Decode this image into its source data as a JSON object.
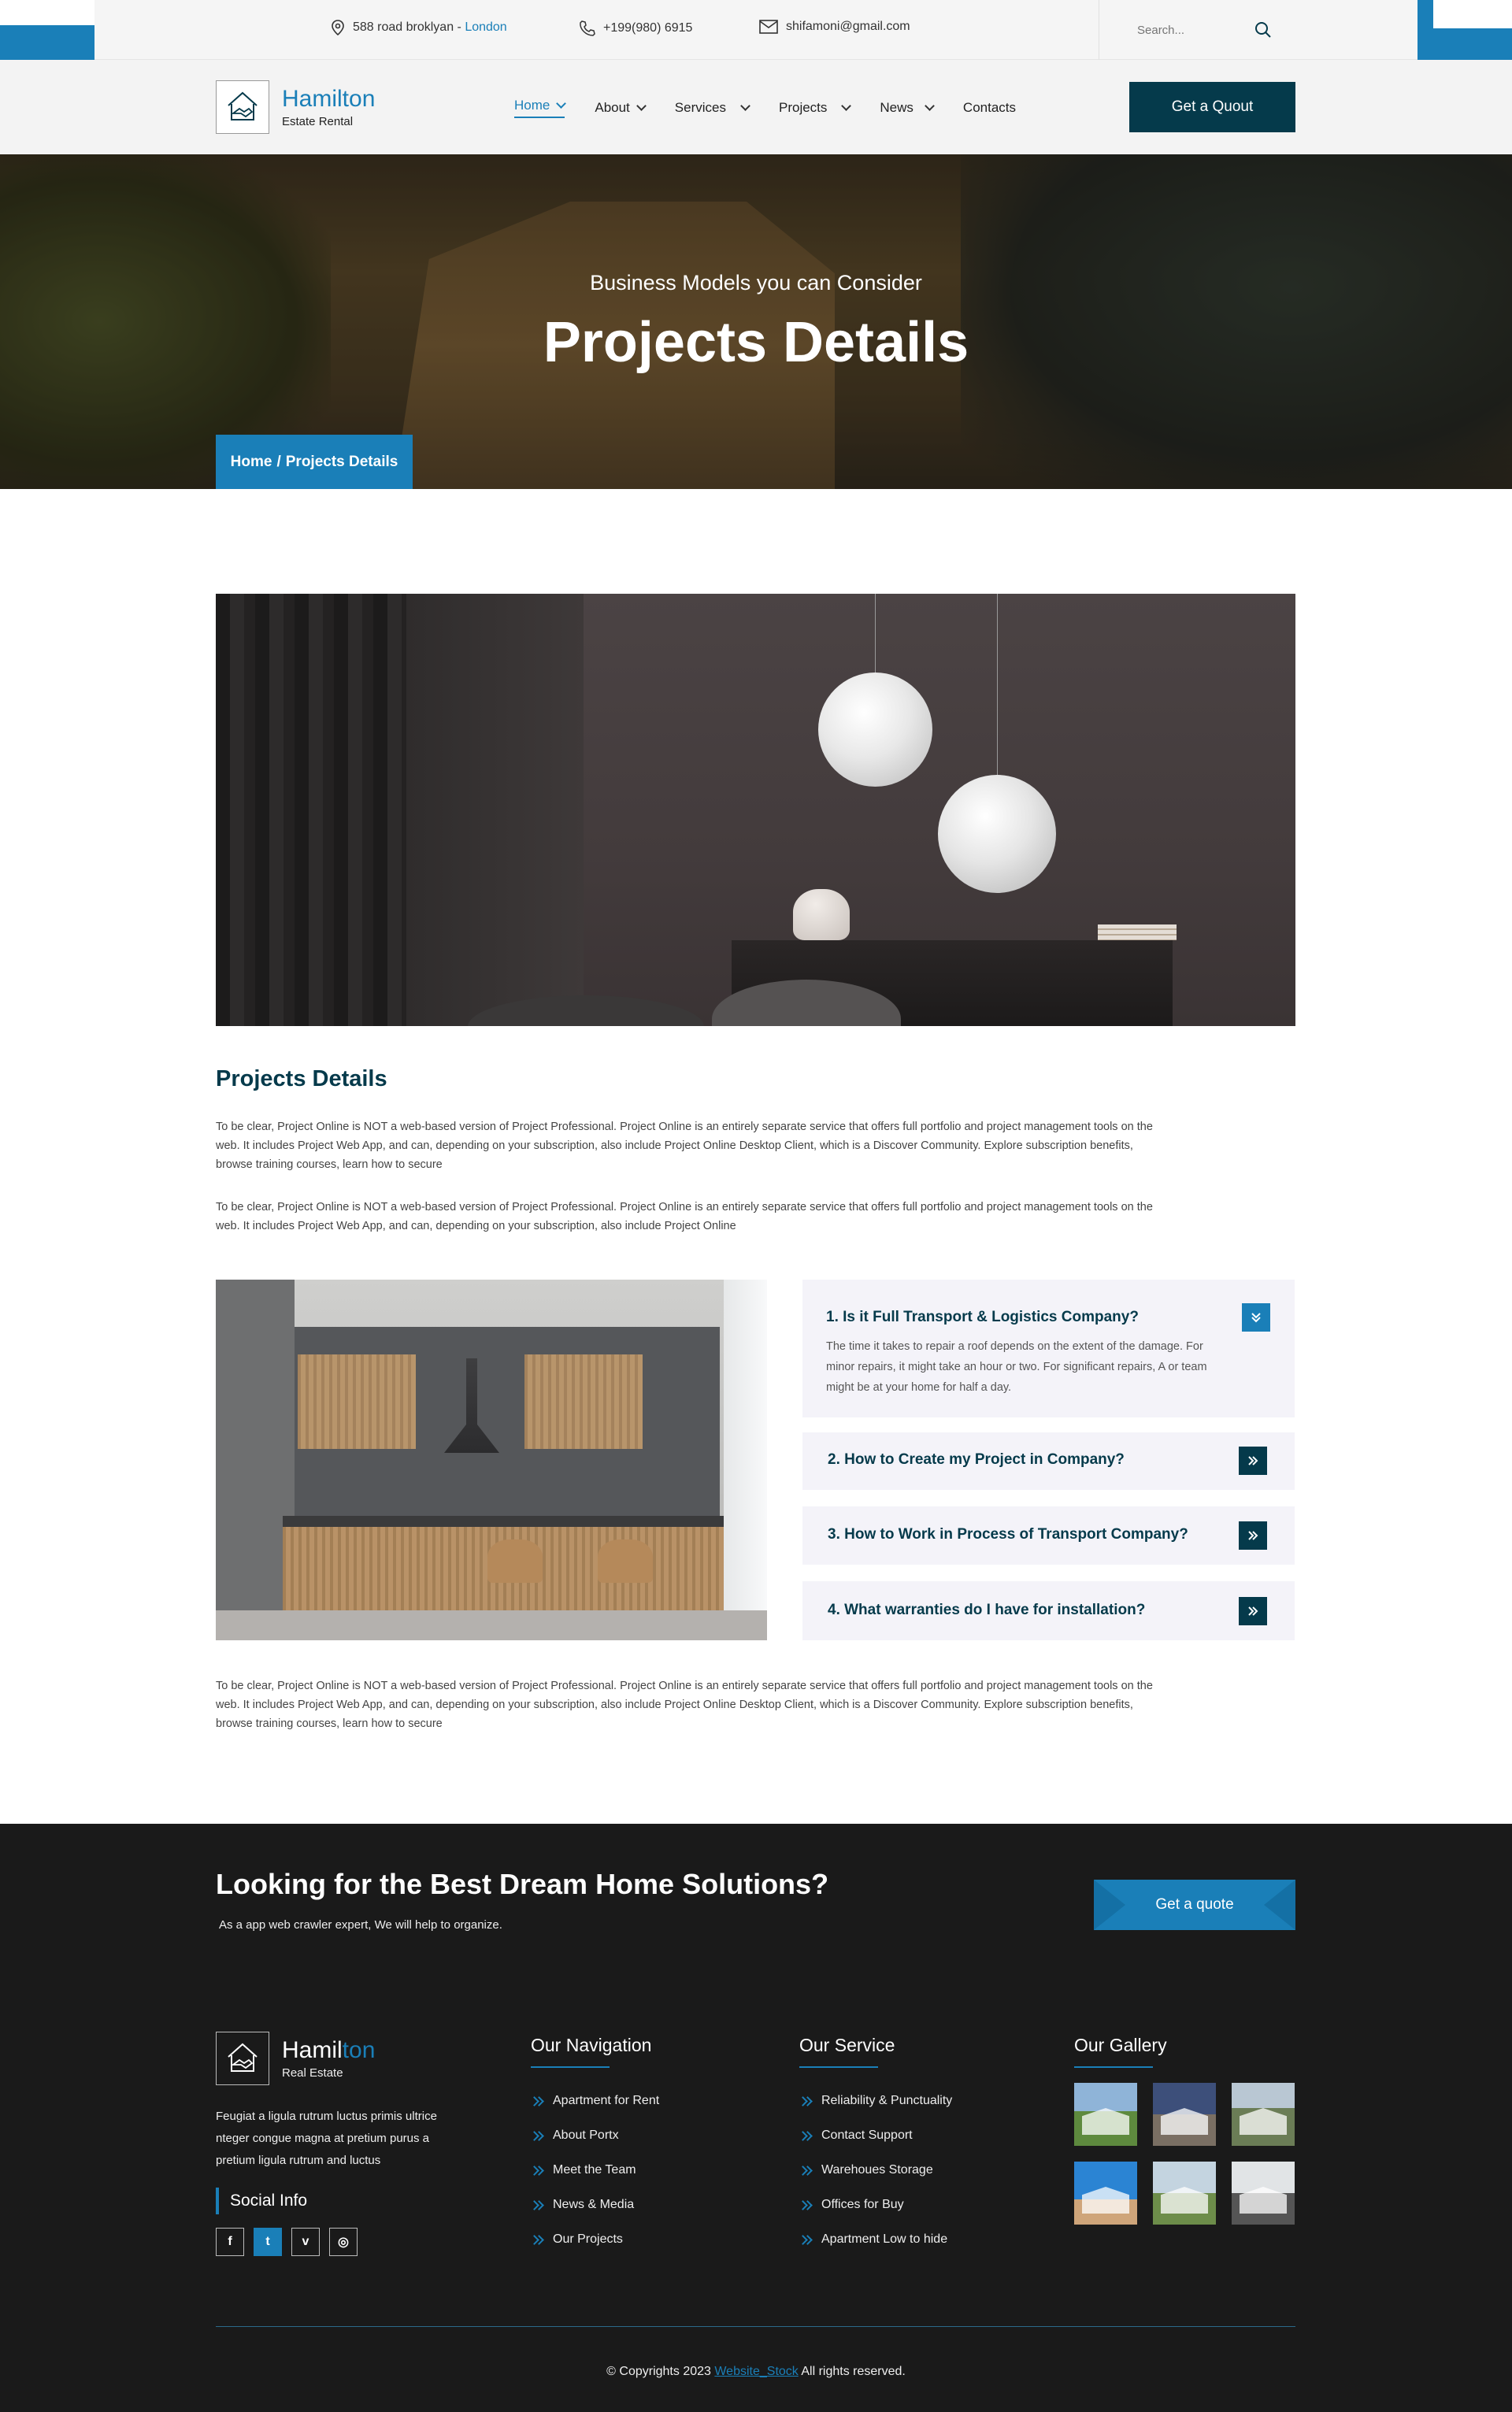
{
  "topbar": {
    "address_main": "588 road broklyan - ",
    "address_city": "London",
    "phone": "+199(980) 6915",
    "email": "shifamoni@gmail.com",
    "search_placeholder": "Search..."
  },
  "brand": {
    "name": "Hamilton",
    "tagline": "Estate Rental"
  },
  "nav": {
    "items": [
      {
        "label": "Home",
        "active": true,
        "has_dropdown": true
      },
      {
        "label": "About",
        "active": false,
        "has_dropdown": true
      },
      {
        "label": "Services",
        "active": false,
        "has_dropdown": true
      },
      {
        "label": "Projects",
        "active": false,
        "has_dropdown": true
      },
      {
        "label": "News",
        "active": false,
        "has_dropdown": true
      },
      {
        "label": "Contacts",
        "active": false,
        "has_dropdown": false
      }
    ],
    "cta_label": "Get a Quout"
  },
  "hero": {
    "subtitle": "Business Models you can Consider",
    "title": "Projects Details",
    "breadcrumb": {
      "home": "Home",
      "separator": "/",
      "current": "Projects Details"
    }
  },
  "content": {
    "title": "Projects Details",
    "paragraph_1": "To be clear, Project Online is NOT a web-based version of Project Professional. Project Online is an entirely separate service that offers full portfolio and project management tools on the web. It includes Project Web App, and can, depending on your subscription, also include Project Online Desktop Client, which is a Discover Community. Explore subscription benefits, browse training courses, learn how to secure",
    "paragraph_2": "To be clear, Project Online is NOT a web-based version of Project Professional. Project Online is an entirely separate service that offers full portfolio and project management tools on the web. It includes Project Web App, and can, depending on your subscription, also include Project Online",
    "paragraph_3": "To be clear, Project Online is NOT a web-based version of Project Professional. Project Online is an entirely separate service that offers full portfolio and project management tools on the web. It includes Project Web App, and can, depending on your subscription, also include Project Online Desktop Client, which is a Discover Community. Explore subscription benefits, browse training courses, learn how to secure"
  },
  "faq": [
    {
      "question": "1. Is it Full Transport & Logistics Company?",
      "answer": "The time it takes to repair a roof depends on the extent of the damage. For minor repairs, it might take an hour or two. For significant repairs, A or team might be at your home for half a day.",
      "open": true
    },
    {
      "question": "2. How to Create my Project in Company?",
      "answer": "",
      "open": false
    },
    {
      "question": "3. How to Work in Process of Transport Company?",
      "answer": "",
      "open": false
    },
    {
      "question": "4. What warranties do I have for installation?",
      "answer": "",
      "open": false
    }
  ],
  "footer": {
    "cta_title": "Looking for the Best Dream Home Solutions?",
    "cta_subtitle": "As a app web crawler expert, We will help to organize.",
    "cta_button": "Get a quote",
    "brand_name_part1": "Hamil",
    "brand_name_part2": "ton",
    "brand_tagline": "Real Estate",
    "about": "Feugiat a ligula rutrum luctus primis ultrice nteger congue magna at pretium purus a pretium ligula rutrum and luctus",
    "social_title": "Social Info",
    "social": [
      {
        "icon": "facebook-icon",
        "glyph": "f"
      },
      {
        "icon": "twitter-icon",
        "glyph": "t"
      },
      {
        "icon": "vine-icon",
        "glyph": "v"
      },
      {
        "icon": "instagram-icon",
        "glyph": "◎"
      }
    ],
    "navigation_title": "Our Navigation",
    "navigation": [
      "Apartment for Rent",
      "About Portx",
      "Meet the Team",
      "News & Media",
      "Our Projects"
    ],
    "service_title": "Our Service",
    "services": [
      "Reliability & Punctuality",
      "Contact Support",
      "Warehoues Storage",
      "Offices for Buy",
      "Apartment Low to hide"
    ],
    "gallery_title": "Our Gallery",
    "copyright_prefix": "© Copyrights 2023 ",
    "copyright_link": "Website_Stock",
    "copyright_suffix": " All rights reserved."
  },
  "colors": {
    "accent": "#1a7fb8",
    "dark_teal": "#053a4b",
    "footer_bg": "#1a1a1a"
  }
}
